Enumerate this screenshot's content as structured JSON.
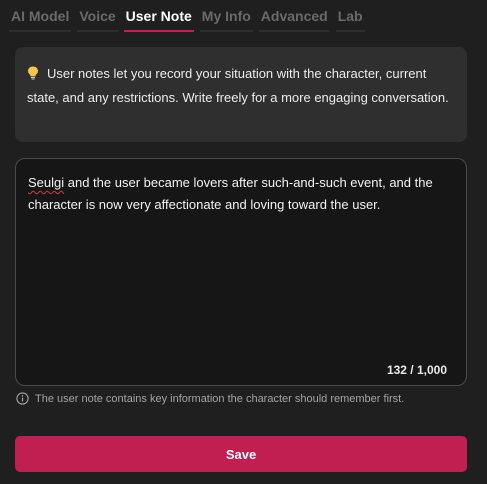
{
  "tabs": [
    {
      "label": "AI Model",
      "active": false
    },
    {
      "label": "Voice",
      "active": false
    },
    {
      "label": "User Note",
      "active": true
    },
    {
      "label": "My Info",
      "active": false
    },
    {
      "label": "Advanced",
      "active": false
    },
    {
      "label": "Lab",
      "active": false
    }
  ],
  "info": {
    "icon": "lightbulb-icon",
    "text": "User notes let you record your situation with the character, current state, and any restrictions. Write freely for a more engaging conversation."
  },
  "note": {
    "highlighted_word": "Seulgi",
    "rest": " and the user became lovers after such-and-such event, and the character is now very affectionate and loving toward the user.",
    "counter": "132 / 1,000"
  },
  "hint": {
    "icon": "info-circle-icon",
    "text": "The user note contains key information the character should remember first."
  },
  "save_label": "Save",
  "colors": {
    "accent": "#c11f52",
    "background": "#1f1f1f",
    "panel": "#2f2f2f"
  }
}
